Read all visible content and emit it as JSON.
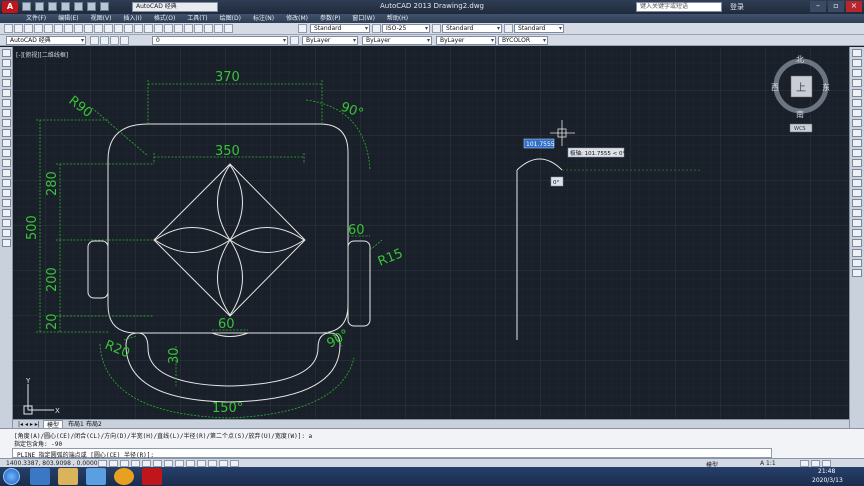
{
  "window": {
    "app_letter": "A",
    "workspace": "AutoCAD 经典",
    "title": "AutoCAD 2013    Drawing2.dwg",
    "search_placeholder": "键入关键字或短语",
    "login": "登录"
  },
  "menu": [
    "文件(F)",
    "编辑(E)",
    "视图(V)",
    "插入(I)",
    "格式(O)",
    "工具(T)",
    "绘图(D)",
    "标注(N)",
    "修改(M)",
    "参数(P)",
    "窗口(W)",
    "帮助(H)"
  ],
  "styles": {
    "text_style": "Standard",
    "dim_style": "ISO-25",
    "table_style": "Standard",
    "mleader_style": "Standard"
  },
  "layers": {
    "workspace": "AutoCAD 经典",
    "current_layer": "0",
    "color": "ByLayer",
    "linetype": "ByLayer",
    "lineweight": "ByLayer",
    "plot_style": "BYCOLOR"
  },
  "viewport_label": "[-][俯视][二维线框]",
  "viewcube": {
    "north": "北",
    "south": "南",
    "east": "东",
    "west": "西",
    "top": "上",
    "wcs": "WCS"
  },
  "dims": {
    "d370": "370",
    "d350": "350",
    "r90": "R90",
    "a90": "90°",
    "d280": "280",
    "d500": "500",
    "d200": "200",
    "d20": "20",
    "d60": "60",
    "r15": "R15",
    "d60b": "60",
    "r20": "R20",
    "d30": "30",
    "a150": "150°",
    "a90b": "90°"
  },
  "dynamic_input": {
    "value": "101.7555",
    "tooltip": "极轴: 101.7555 < 0°",
    "angle": "0°"
  },
  "ucs": {
    "x": "X",
    "y": "Y"
  },
  "layout_tabs": [
    "模型",
    "布局1",
    "布局2"
  ],
  "command": {
    "line1": "[角度(A)/圆心(CE)/闭合(CL)/方向(D)/半宽(H)/直线(L)/半径(R)/第二个点(S)/放弃(U)/宽度(W)]: a",
    "line2": "指定包含角: -90",
    "prompt": "PLINE 指定圆弧的端点或 [圆心(CE) 半径(R)]:"
  },
  "status": {
    "coords": "1400.3387, 803.9098 , 0.0000",
    "model": "模型",
    "scale": "A 1:1"
  },
  "clock": {
    "time": "21:48",
    "date": "2020/3/13"
  },
  "colors": {
    "canvas": "#1a2029",
    "grid": "#2c3440",
    "lines": "#e6e6e6",
    "dims": "#2db32d",
    "dim_text": "#39c339"
  }
}
